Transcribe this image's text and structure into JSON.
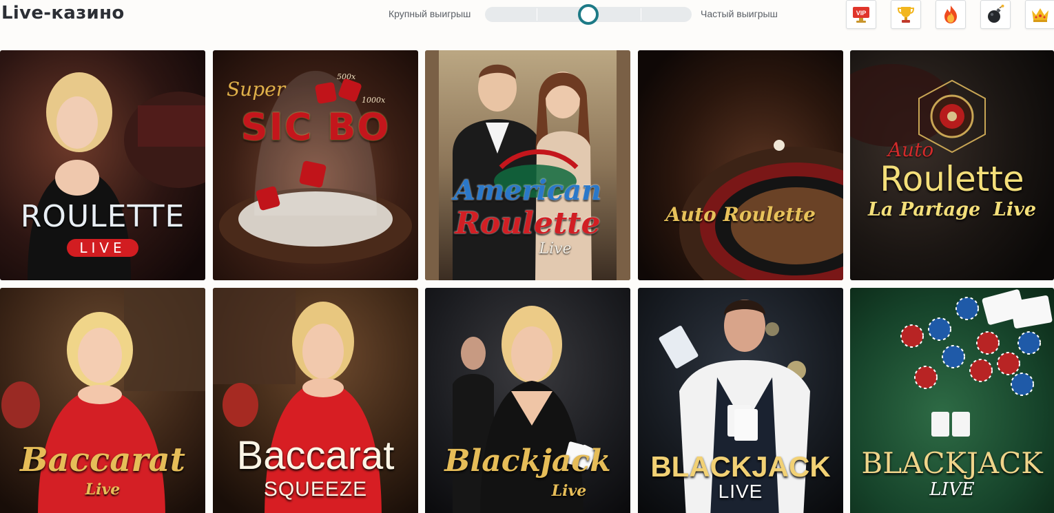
{
  "header": {
    "title": "Live-казино",
    "slider_left_label": "Крупный выигрыш",
    "slider_right_label": "Частый выигрыш",
    "slider_value": 0.5
  },
  "filters": [
    {
      "id": "vip",
      "label": "VIP",
      "icon": "vip-icon"
    },
    {
      "id": "top",
      "icon": "trophy-icon"
    },
    {
      "id": "hot",
      "icon": "fire-icon"
    },
    {
      "id": "bomb",
      "icon": "bomb-icon"
    },
    {
      "id": "crown",
      "icon": "crown-icon"
    }
  ],
  "games": [
    {
      "title_main": "ROULETTE",
      "title_sub": "LIVE"
    },
    {
      "title_main": "SIC BO",
      "title_pre": "Super",
      "title_tag1": "500x",
      "title_tag2": "1000x"
    },
    {
      "title_main": "American",
      "title_second": "Roulette",
      "title_sub": "Live"
    },
    {
      "title_main": "Auto Roulette"
    },
    {
      "title_pre": "Auto",
      "title_main": "Roulette",
      "title_sub": "La Partage  Live"
    },
    {
      "title_main": "Baccarat",
      "title_sub": "Live"
    },
    {
      "title_main": "Baccarat",
      "title_sub": "SQUEEZE"
    },
    {
      "title_main": "Blackjack",
      "title_sub": "Live"
    },
    {
      "title_main": "BLACKJACK",
      "title_sub": "LIVE"
    },
    {
      "title_main": "BLACKJACK",
      "title_sub": "LIVE"
    }
  ],
  "colors": {
    "accent": "#1d7a86",
    "track": "#e7eaec",
    "page_bg": "#fdfcfa",
    "title": "#2c2f35"
  }
}
